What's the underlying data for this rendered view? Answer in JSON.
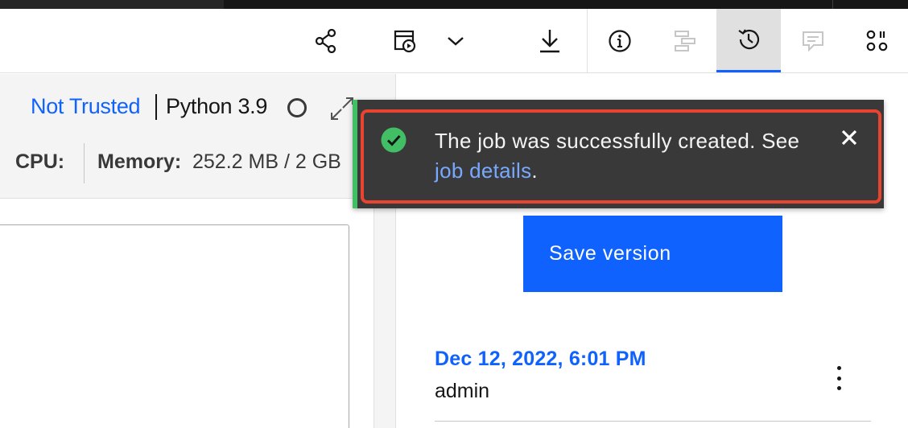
{
  "notebook": {
    "trust_status": "Not Trusted",
    "kernel": "Python 3.9",
    "cpu_label": "CPU:",
    "memory_label": "Memory:",
    "memory_value": "252.2 MB / 2 GB"
  },
  "toolbar": {
    "icons": [
      "share-icon",
      "schedule-job-icon",
      "chevron-down-icon",
      "download-icon",
      "info-icon",
      "data-icon",
      "version-history-icon",
      "comments-icon",
      "code-snippets-icon"
    ],
    "active_tab": "version-history"
  },
  "toast": {
    "message": "The job was successfully created. See",
    "link_text": "job details",
    "suffix": ".",
    "status": "success"
  },
  "versions_panel": {
    "save_button": "Save version",
    "versions": [
      {
        "date": "Dec 12, 2022, 6:01 PM",
        "user": "admin"
      }
    ]
  },
  "colors": {
    "accent": "#0f62fe",
    "success": "#42be65",
    "toast_bg": "#393939",
    "highlight": "#e8442f"
  }
}
